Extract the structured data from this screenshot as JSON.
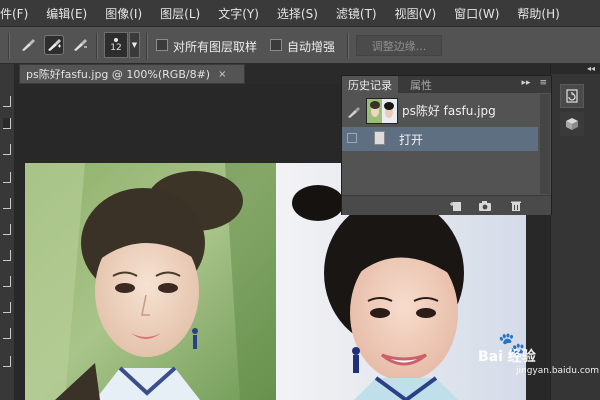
{
  "menubar": {
    "items": [
      "编辑(E)",
      "图像(I)",
      "图层(L)",
      "文字(Y)",
      "选择(S)",
      "滤镜(T)",
      "视图(V)",
      "窗口(W)",
      "帮助(H)"
    ],
    "clipped_first": "件(F)"
  },
  "options": {
    "brush_size": "12",
    "sample_all_layers_label": "对所有图层取样",
    "auto_enhance_label": "自动增强",
    "refine_edge_label": "调整边缘..."
  },
  "document": {
    "tab_title": "ps陈好fasfu.jpg @ 100%(RGB/8#)",
    "close_glyph": "×"
  },
  "history_panel": {
    "tab_history": "历史记录",
    "tab_properties": "属性",
    "collapse_glyph": "▸▸",
    "menu_glyph": "≡",
    "snapshot_name": "ps陈好 fasfu.jpg",
    "states": [
      {
        "label": "打开",
        "selected": true
      }
    ]
  },
  "right_strip": {
    "collapse_glyph": "◂◂"
  },
  "watermark": {
    "text": "Bai  经验",
    "paw": "🐾",
    "sub": "jingyan.baidu.com"
  },
  "colors": {
    "menubar": "#3a3a3a",
    "optionsbar": "#535353",
    "workspace": "#282828",
    "history_selection": "#5e6f82"
  }
}
